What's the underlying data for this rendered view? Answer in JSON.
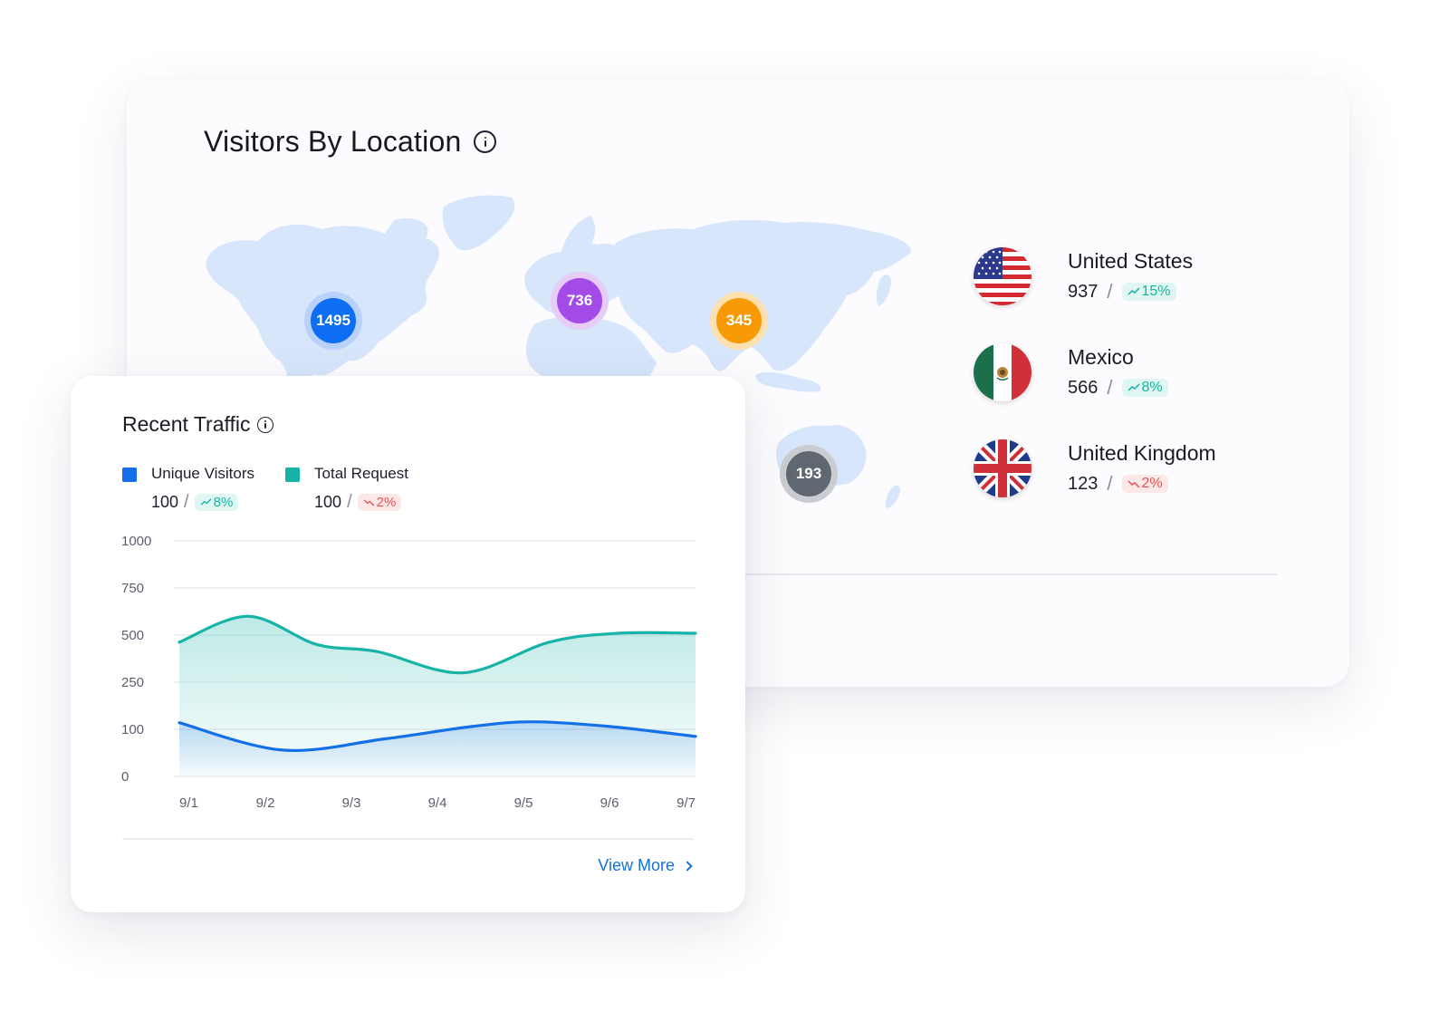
{
  "location_card": {
    "title": "Visitors By Location",
    "markers": [
      {
        "label": "1495",
        "color": "#0d6ef4",
        "halo": "#b9d2fb"
      },
      {
        "label": "736",
        "color": "#a24be6",
        "halo": "#e5cdf8"
      },
      {
        "label": "345",
        "color": "#f89a05",
        "halo": "#fde0b0"
      },
      {
        "label": "193",
        "color": "#5f6870",
        "halo": "#c9cdd2"
      }
    ],
    "countries": [
      {
        "name": "United States",
        "value": "937",
        "change": "15%",
        "trend": "up"
      },
      {
        "name": "Mexico",
        "value": "566",
        "change": "8%",
        "trend": "up"
      },
      {
        "name": "United Kingdom",
        "value": "123",
        "change": "2%",
        "trend": "down"
      }
    ]
  },
  "traffic_card": {
    "title": "Recent Traffic",
    "legend": [
      {
        "name": "Unique Visitors",
        "value": "100",
        "change": "8%",
        "trend": "up",
        "color": "#1470e8"
      },
      {
        "name": "Total Request",
        "value": "100",
        "change": "2%",
        "trend": "down",
        "color": "#16b3a6"
      }
    ],
    "view_more": "View More"
  },
  "chart_data": {
    "type": "area",
    "categories": [
      "9/1",
      "9/2",
      "9/3",
      "9/4",
      "9/5",
      "9/6",
      "9/7"
    ],
    "y_ticks": [
      "0",
      "100",
      "250",
      "500",
      "750",
      "1000"
    ],
    "grid": true,
    "series": [
      {
        "name": "Total Request",
        "color": "#16b3a6",
        "points": [
          [
            0,
            2.85
          ],
          [
            0.8,
            3.4
          ],
          [
            1.6,
            2.8
          ],
          [
            2.3,
            2.65
          ],
          [
            3.3,
            2.2
          ],
          [
            4.3,
            2.85
          ],
          [
            5.1,
            3.04
          ],
          [
            6,
            3.04
          ]
        ]
      },
      {
        "name": "Unique Visitors",
        "color": "#1470e8",
        "points": [
          [
            0,
            1.14
          ],
          [
            1.2,
            0.56
          ],
          [
            2.4,
            0.8
          ],
          [
            3.4,
            1.06
          ],
          [
            4.1,
            1.16
          ],
          [
            5,
            1.06
          ],
          [
            6,
            0.85
          ]
        ]
      }
    ]
  }
}
